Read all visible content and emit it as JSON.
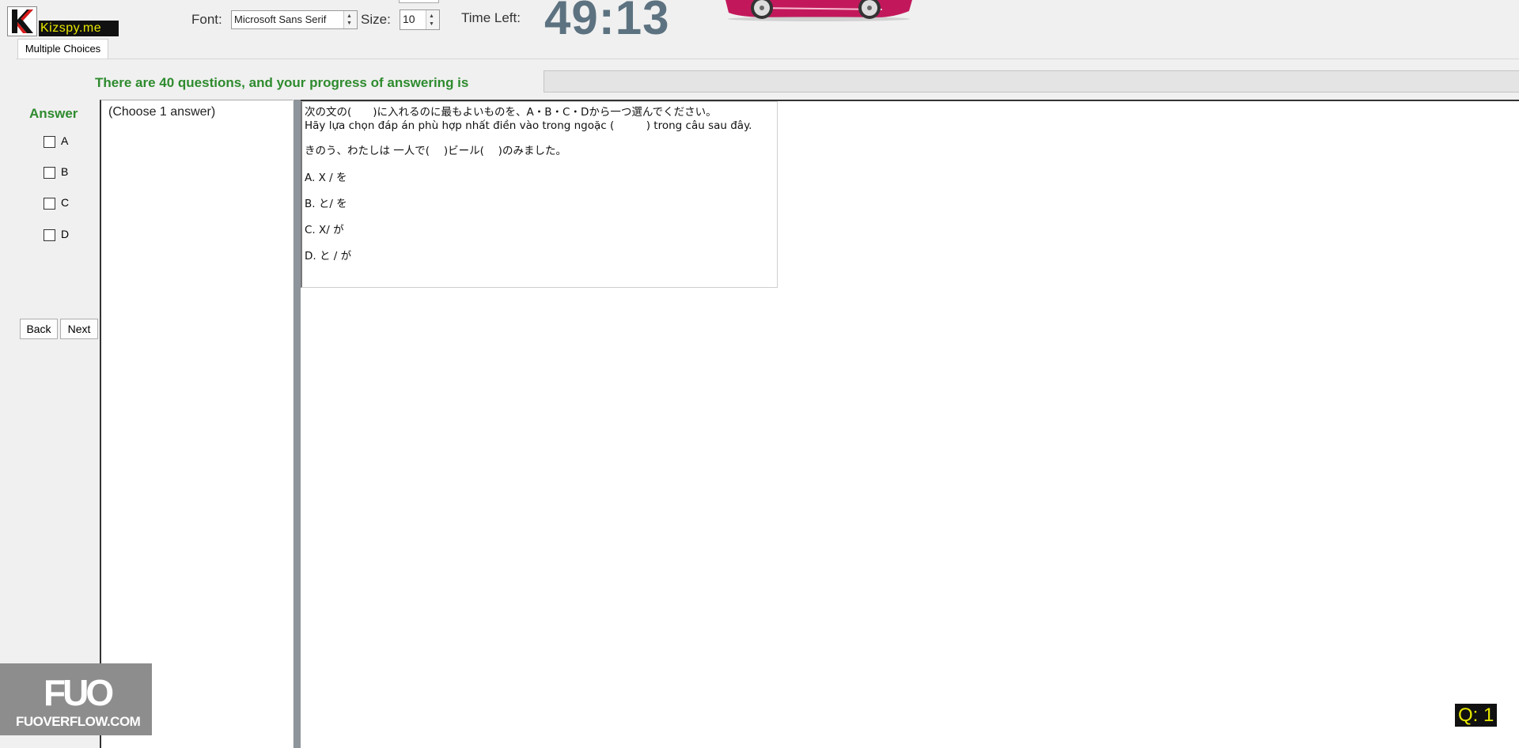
{
  "app": {
    "brand": "Kizspy.me"
  },
  "toolbar": {
    "font_label": "Font:",
    "font_value": "Microsoft Sans Serif",
    "size_label": "Size:",
    "size_value": "10",
    "time_left_label": "Time Left:",
    "timer": "49:13"
  },
  "tabs": [
    {
      "label": "Multiple Choices"
    }
  ],
  "progress": {
    "text": "There are 40 questions, and your progress of answering is",
    "fraction": 0
  },
  "answer": {
    "header": "Answer",
    "options": [
      "A",
      "B",
      "C",
      "D"
    ]
  },
  "nav": {
    "back": "Back",
    "next": "Next"
  },
  "choose_hint": "(Choose 1 answer)",
  "question": {
    "instruction_jp": "次の文の(　　)に入れるのに最もよいものを、A・B・C・Dから一つ選んでください。",
    "instruction_vi": "Hãy lựa chọn đáp án phù hợp nhất điền vào trong ngoặc (　　　) trong câu sau đây.",
    "sentence": "きのう、わたしは 一人で(　 )ビール(　 )のみました。",
    "choices": [
      "A.  X / を",
      "B.  と/ を",
      "C.  X/ が",
      "D.  と / が"
    ]
  },
  "watermark": {
    "logo": "FUO",
    "site": "FUOVERFLOW.COM"
  },
  "question_number": "Q: 1",
  "colors": {
    "accent_green": "#2e8b2e",
    "timer": "#5c7280",
    "brand_bg": "#111111",
    "brand_fg": "#e8e800",
    "car": "#c2185b"
  }
}
